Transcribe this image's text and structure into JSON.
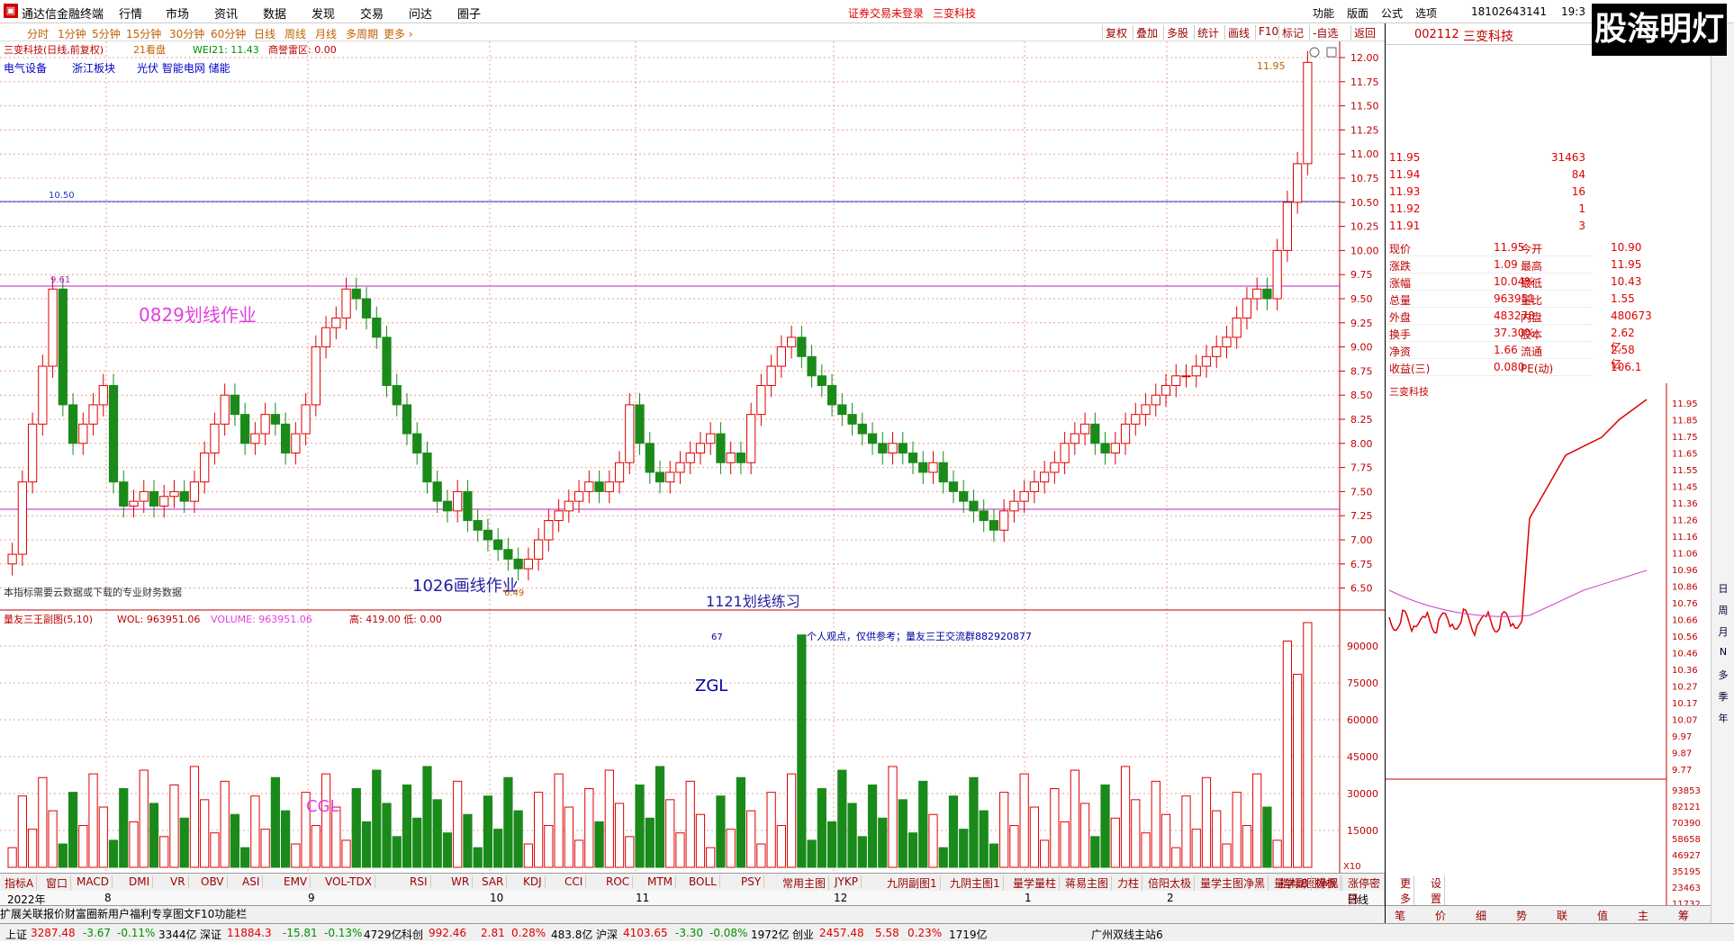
{
  "menu": {
    "app": "通达信金融终端",
    "items": [
      "行情",
      "市场",
      "资讯",
      "数据",
      "发现",
      "交易",
      "问达",
      "圈子"
    ],
    "notice": "证券交易未登录",
    "stock_title": "三变科技",
    "right_items": [
      "功能",
      "版面",
      "公式",
      "选项"
    ],
    "phone": "18102643141",
    "time": "19:3"
  },
  "watermark": "股海明灯",
  "periods": [
    "分时",
    "1分钟",
    "5分钟",
    "15分钟",
    "30分钟",
    "60分钟",
    "日线",
    "周线",
    "月线",
    "多周期",
    "更多 ›"
  ],
  "toolbar_right": [
    "复权",
    "叠加",
    "多股",
    "统计",
    "画线",
    "F10",
    "标记",
    "-自选",
    "返回"
  ],
  "chart": {
    "title": "三变科技(日线,前复权)",
    "period_tag": "21看盘",
    "wei": "WEI21: 11.43",
    "rader": "商誉雷区: 0.00",
    "sectors": [
      "电气设备",
      "浙江板块",
      "光伏 智能电网 储能"
    ],
    "price_ticks": [
      "12.00",
      "11.75",
      "11.50",
      "11.25",
      "11.00",
      "10.75",
      "10.50",
      "10.25",
      "10.00",
      "9.75",
      "9.50",
      "9.25",
      "9.00",
      "8.75",
      "8.50",
      "8.25",
      "8.00",
      "7.75",
      "7.50",
      "7.25",
      "7.00",
      "6.75",
      "6.50"
    ],
    "annotation_0829": "0829划线作业",
    "annotation_1026": "1026画线作业",
    "annotation_1121": "1121划线练习",
    "label_1050": "10.50",
    "label_961": "9.61",
    "label_1195": "11.95",
    "label_649": "6.49",
    "note": "本指标需要云数据或下载的专业财务数据",
    "vol_title": "量友三王副图(5,10)",
    "wol": "WOL: 963951.06",
    "volume": "VOLUME: 963951.06",
    "hilo": "高: 419.00  低: 0.00",
    "vol_note": "个人观点，仅供参考；量友三王交流群882920877",
    "zgl": "ZGL",
    "cgl": "CGL",
    "vol_67": "67",
    "vol_ticks": [
      "90000",
      "75000",
      "60000",
      "45000",
      "30000",
      "15000"
    ],
    "x10": "X10"
  },
  "dates": [
    "2022年",
    "8",
    "9",
    "10",
    "11",
    "12",
    "1",
    "2"
  ],
  "date_mode": "日线",
  "bottom_tabs": [
    "指标A",
    "窗口",
    "MACD",
    "DMI",
    "VR",
    "OBV",
    "ASI",
    "EMV",
    "VOL-TDX",
    "RSI",
    "WR",
    "SAR",
    "KDJ",
    "CCI",
    "ROC",
    "MTM",
    "BOLL",
    "PSY",
    "常用主图",
    "JYKP",
    "九阴副图1",
    "九阴主图1",
    "量学量柱",
    "蒋易主图",
    "力柱",
    "倍阳太极",
    "量学主图净黑",
    "量学副图净黑",
    "涨停密码",
    "更多",
    "设置"
  ],
  "bottom_tabs_right": [
    "指标B",
    "模板"
  ],
  "bottom_tabs2": [
    "扩展",
    "关联报价",
    "财富圈"
  ],
  "bottom_tabs2_right": [
    "新用户福利专享",
    "图文F10",
    "功能栏"
  ],
  "quote": {
    "code": "002112",
    "name": "三变科技",
    "levels": [
      [
        "11.95",
        "31463"
      ],
      [
        "11.94",
        "84"
      ],
      [
        "11.93",
        "16"
      ],
      [
        "11.92",
        "1"
      ],
      [
        "11.91",
        "3"
      ]
    ],
    "rows": [
      [
        "现价",
        "11.95",
        "今开",
        "10.90"
      ],
      [
        "涨跌",
        "1.09",
        "最高",
        "11.95"
      ],
      [
        "涨幅",
        "10.04%",
        "最低",
        "10.43"
      ],
      [
        "总量",
        "963951",
        "量比",
        "1.55"
      ],
      [
        "外盘",
        "483278",
        "内盘",
        "480673"
      ],
      [
        "换手",
        "37.30%",
        "股本",
        "2.62亿"
      ],
      [
        "净资",
        "1.66",
        "流通",
        "2.58亿"
      ],
      [
        "收益(三)",
        "0.080",
        "PE(动)",
        "106.1"
      ]
    ]
  },
  "intraday": {
    "title": "三变科技",
    "price_ticks": [
      "11.95",
      "11.85",
      "11.75",
      "11.65",
      "11.55",
      "11.45",
      "11.36",
      "11.26",
      "11.16",
      "11.06",
      "10.96",
      "10.86",
      "10.76",
      "10.66",
      "10.56",
      "10.46",
      "10.36",
      "10.27",
      "10.17",
      "10.07",
      "9.97",
      "9.87",
      "9.77"
    ],
    "vol_ticks": [
      "93853",
      "82121",
      "70390",
      "58658",
      "46927",
      "35195",
      "23463",
      "11732"
    ],
    "tabs": [
      "笔",
      "价",
      "细",
      "势",
      "联",
      "值",
      "主",
      "筹"
    ]
  },
  "sidebar": [
    "日",
    "周",
    "月",
    "N",
    "多",
    "季",
    "年"
  ],
  "status": {
    "sh": "上证",
    "sh_v": "3287.48",
    "sh_c": "-3.67",
    "sh_p": "-0.11%",
    "sh_a": "3344亿",
    "sz": "深证",
    "sz_v": "11884.3",
    "sz_c": "-15.81",
    "sz_p": "-0.13%",
    "sz_a": "4729亿",
    "kc": "科创",
    "kc_v": "992.46",
    "kc_c": "2.81",
    "kc_p": "0.28%",
    "kc_a": "483.8亿",
    "hs": "沪深",
    "hs_v": "4103.65",
    "hs_c": "-3.30",
    "hs_p": "-0.08%",
    "hs_a": "1972亿",
    "cy": "创业",
    "cy_v": "2457.48",
    "cy_c": "5.58",
    "cy_p": "0.23%",
    "cy_a": "1719亿",
    "server": "广州双线主站6"
  },
  "colors": {
    "up": "#e00000",
    "down": "#1a8a1a",
    "bg": "#ffffff",
    "grid": "#e08080",
    "line_blue": "#3030c0",
    "line_magenta": "#d040d0"
  }
}
